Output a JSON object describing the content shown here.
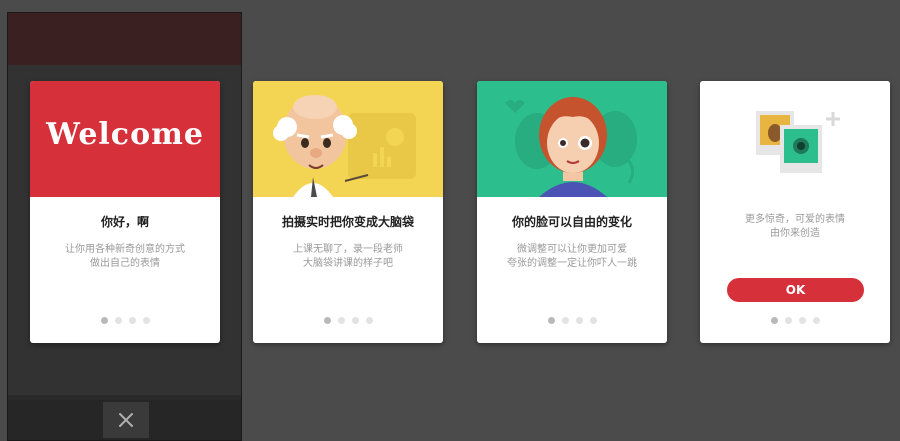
{
  "colors": {
    "background": "#4b4b4b",
    "card1_top": "#d6303a",
    "card2_top": "#f4d553",
    "card3_top": "#2dbe8d",
    "ok_button": "#d6303a"
  },
  "cards": [
    {
      "banner_text": "Welcome",
      "title": "你好，啊",
      "desc_line1": "让你用各种新奇创意的方式",
      "desc_line2": "做出自己的表情",
      "active_dot": 1
    },
    {
      "title": "拍摄实时把你变成大脑袋",
      "desc_line1": "上课无聊了，录一段老师",
      "desc_line2": "大脑袋讲课的样子吧",
      "active_dot": 1
    },
    {
      "title": "你的脸可以自由的变化",
      "desc_line1": "微调整可以让你更加可爱",
      "desc_line2": "夸张的调整一定让你吓人一跳",
      "active_dot": 1
    },
    {
      "desc_line1": "更多惊奇，可爱的表情",
      "desc_line2": "由你来创造",
      "button_label": "OK",
      "active_dot": 1
    }
  ],
  "icons": {
    "close": "close-icon",
    "card1": "welcome-banner",
    "card2": "professor-illustration",
    "card3": "girl-illustration",
    "card4": "photos-plus-icon"
  }
}
